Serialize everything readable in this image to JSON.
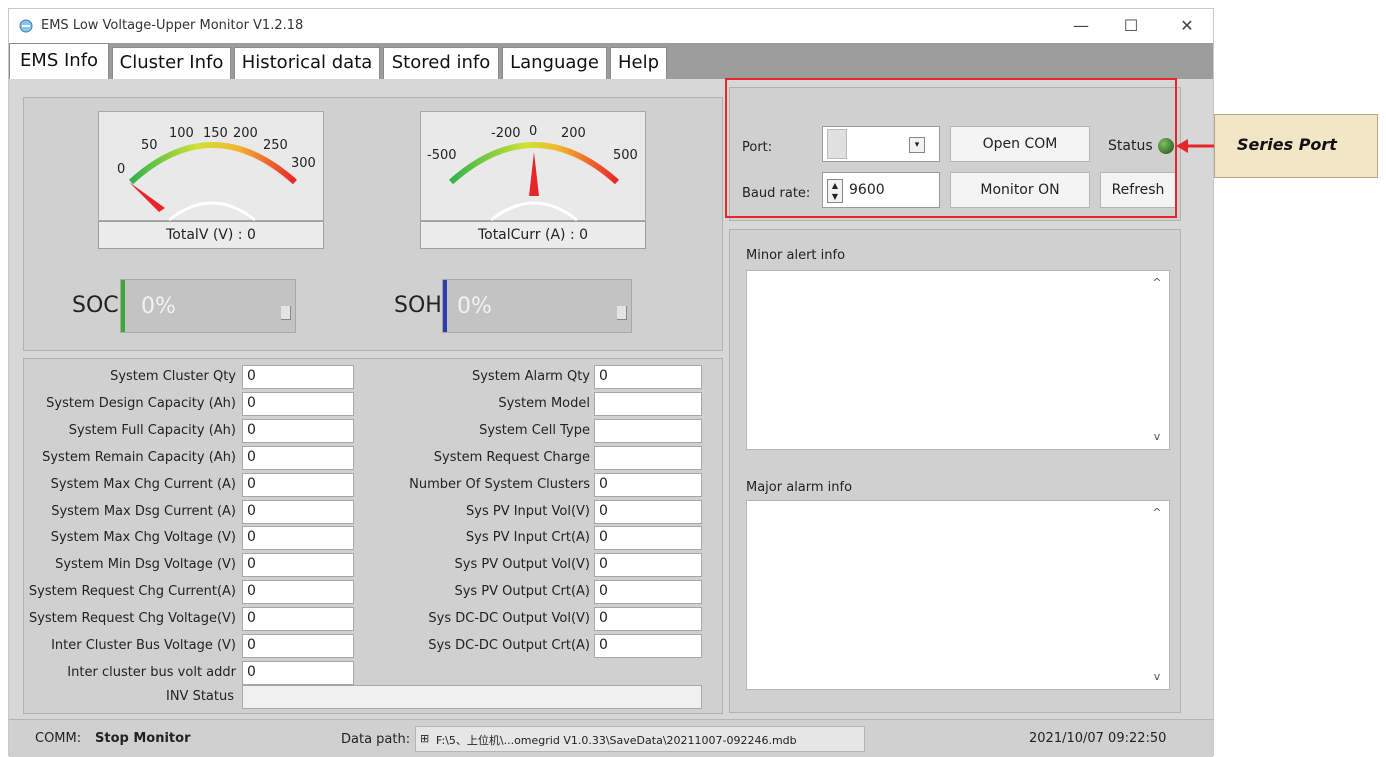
{
  "window": {
    "title": "EMS Low Voltage-Upper Monitor V1.2.18",
    "minimize": "—",
    "maximize": "☐",
    "close": "✕"
  },
  "tabs": [
    "EMS Info",
    "Cluster Info",
    "Historical data",
    "Stored info",
    "Language",
    "Help"
  ],
  "gauges": {
    "voltage": {
      "ticks": [
        "0",
        "50",
        "100",
        "150",
        "200",
        "250",
        "300"
      ],
      "label": "TotalV (V) :  0"
    },
    "current": {
      "ticks": [
        "-500",
        "-200",
        "0",
        "200",
        "500"
      ],
      "label": "TotalCurr (A) :  0"
    }
  },
  "soc": {
    "label": "SOC",
    "value": "0%",
    "fraction": 0
  },
  "soh": {
    "label": "SOH",
    "value": "0%",
    "fraction": 0
  },
  "left_fields": [
    {
      "label": "System Cluster Qty",
      "value": "0"
    },
    {
      "label": "System Design Capacity (Ah)",
      "value": "0"
    },
    {
      "label": "System Full Capacity (Ah)",
      "value": "0"
    },
    {
      "label": "System Remain Capacity (Ah)",
      "value": "0"
    },
    {
      "label": "System Max Chg Current (A)",
      "value": "0"
    },
    {
      "label": "System Max Dsg Current (A)",
      "value": "0"
    },
    {
      "label": "System Max Chg Voltage (V)",
      "value": "0"
    },
    {
      "label": "System Min Dsg Voltage (V)",
      "value": "0"
    },
    {
      "label": "System Request Chg Current(A)",
      "value": "0"
    },
    {
      "label": "System Request Chg Voltage(V)",
      "value": "0"
    },
    {
      "label": "Inter Cluster Bus Voltage  (V)",
      "value": "0"
    },
    {
      "label": "Inter cluster bus volt addr",
      "value": "0"
    }
  ],
  "right_fields": [
    {
      "label": "System Alarm Qty",
      "value": "0"
    },
    {
      "label": "System Model",
      "value": ""
    },
    {
      "label": "System Cell Type",
      "value": ""
    },
    {
      "label": "System Request Charge",
      "value": ""
    },
    {
      "label": "Number Of System Clusters",
      "value": "0"
    },
    {
      "label": "Sys PV Input Vol(V)",
      "value": "0"
    },
    {
      "label": "Sys PV Input Crt(A)",
      "value": "0"
    },
    {
      "label": "Sys PV Output Vol(V)",
      "value": "0"
    },
    {
      "label": "Sys PV Output Crt(A)",
      "value": "0"
    },
    {
      "label": "Sys DC-DC Output Vol(V)",
      "value": "0"
    },
    {
      "label": "Sys DC-DC Output Crt(A)",
      "value": "0"
    }
  ],
  "inv_status": {
    "label": "INV Status",
    "value": ""
  },
  "serial": {
    "port_label": "Port:",
    "port_value": "",
    "open_com": "Open COM",
    "status_label": "Status",
    "baud_label": "Baud rate:",
    "baud_value": "9600",
    "monitor_on": "Monitor ON",
    "refresh": "Refresh"
  },
  "alerts": {
    "minor_title": "Minor alert info",
    "major_title": "Major alarm info",
    "scroll_up": "^",
    "scroll_down": "v"
  },
  "statusbar": {
    "comm_label": "COMM:",
    "comm_value": "Stop Monitor",
    "path_label": "Data path:",
    "path_value": "F:\\5、上位机\\...omegrid V1.0.33\\SaveData\\20211007-092246.mdb",
    "datetime": "2021/10/07 09:22:50"
  },
  "annotation": {
    "label": "Series Port"
  },
  "colors": {
    "highlight": "#e8262a",
    "callout_bg": "#f3e6c6",
    "status_led": "#3a6e2e"
  }
}
